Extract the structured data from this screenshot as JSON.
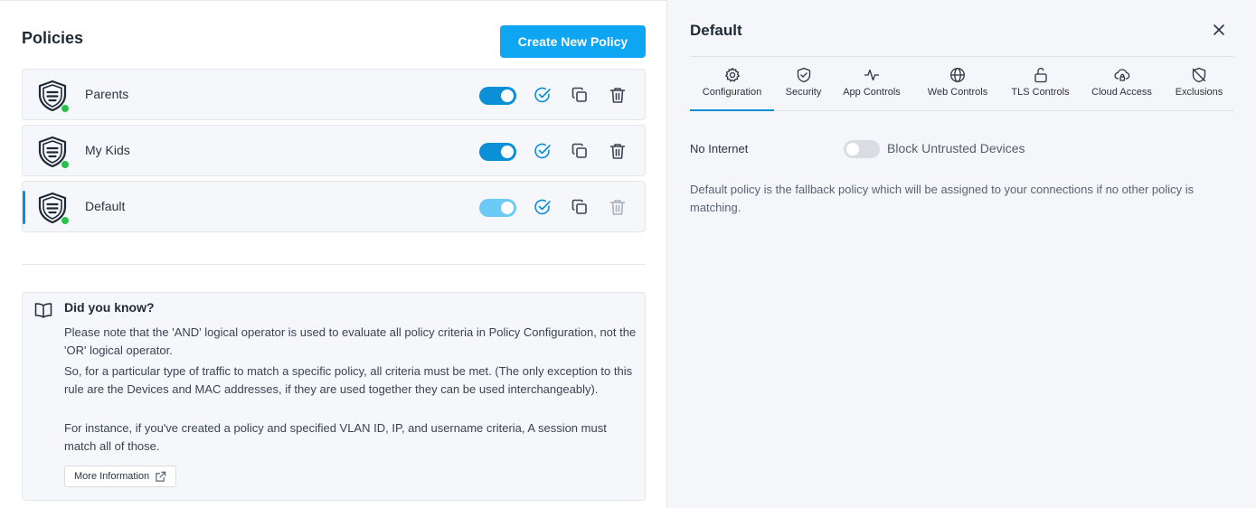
{
  "header": {
    "title": "Policies",
    "create_button": "Create New Policy"
  },
  "policies": [
    {
      "name": "Parents",
      "enabled": true,
      "selected": false
    },
    {
      "name": "My Kids",
      "enabled": true,
      "selected": false
    },
    {
      "name": "Default",
      "enabled": true,
      "selected": true
    }
  ],
  "tip": {
    "title": "Did you know?",
    "p1": "Please note that the 'AND' logical operator is used to evaluate all policy criteria in Policy Configuration, not the 'OR' logical operator.",
    "p2": "So, for a particular type of traffic to match a specific policy, all criteria must be met. (The only exception to this rule are the Devices and MAC addresses, if they are used together they can be used interchangeably).",
    "p3": "For instance, if you've created a policy and specified VLAN ID, IP, and username criteria, A session must match all of those.",
    "more_button": "More Information"
  },
  "panel": {
    "title": "Default",
    "tabs": [
      {
        "label": "Configuration",
        "icon": "gear-icon",
        "active": true
      },
      {
        "label": "Security",
        "icon": "shield-check-icon",
        "active": false
      },
      {
        "label": "App Controls",
        "icon": "activity-icon",
        "active": false
      },
      {
        "label": "Web Controls",
        "icon": "globe-icon",
        "active": false
      },
      {
        "label": "TLS Controls",
        "icon": "unlock-icon",
        "active": false
      },
      {
        "label": "Cloud Access",
        "icon": "cloud-lock-icon",
        "active": false
      },
      {
        "label": "Exclusions",
        "icon": "shield-off-icon",
        "active": false
      }
    ],
    "no_internet_label": "No Internet",
    "block_untrusted_label": "Block Untrusted Devices",
    "block_untrusted_enabled": false,
    "description": "Default policy is the fallback policy which will be assigned to your connections if no other policy is matching."
  },
  "colors": {
    "accent": "#0ea5f2",
    "toggle_on": "#0b8fd6",
    "status_online": "#28c24a"
  }
}
